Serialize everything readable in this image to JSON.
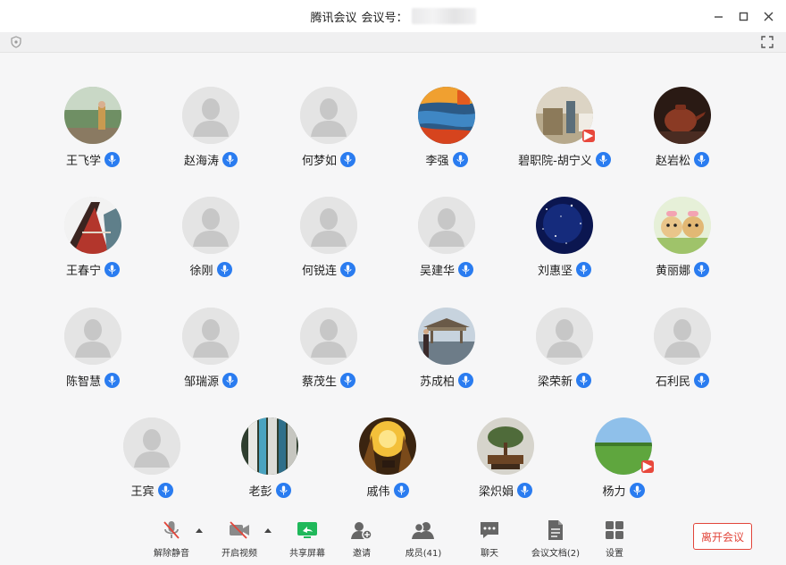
{
  "window": {
    "app_name": "腾讯会议",
    "meeting_label": "会议号："
  },
  "participants_row1": [
    "王飞学",
    "赵海涛",
    "何梦如",
    "李强",
    "碧职院-胡宁义",
    "赵岩松"
  ],
  "participants_row2": [
    "王春宁",
    "徐刚",
    "何锐连",
    "吴建华",
    "刘惠坚",
    "黄丽娜"
  ],
  "participants_row3": [
    "陈智慧",
    "邹瑞源",
    "蔡茂生",
    "苏成柏",
    "梁荣新",
    "石利民"
  ],
  "participants_row4": [
    "王宾",
    "老彭",
    "戚伟",
    "梁炽娟",
    "杨力"
  ],
  "toolbar": {
    "unmute": "解除静音",
    "start_video": "开启视频",
    "share_screen": "共享屏幕",
    "invite": "邀请",
    "members": "成员(41)",
    "chat": "聊天",
    "docs": "会议文档(2)",
    "settings": "设置",
    "leave": "离开会议"
  },
  "colors": {
    "mic_blue": "#2a7cf0",
    "leave_red": "#e2453a",
    "share_green": "#1fb85a"
  }
}
